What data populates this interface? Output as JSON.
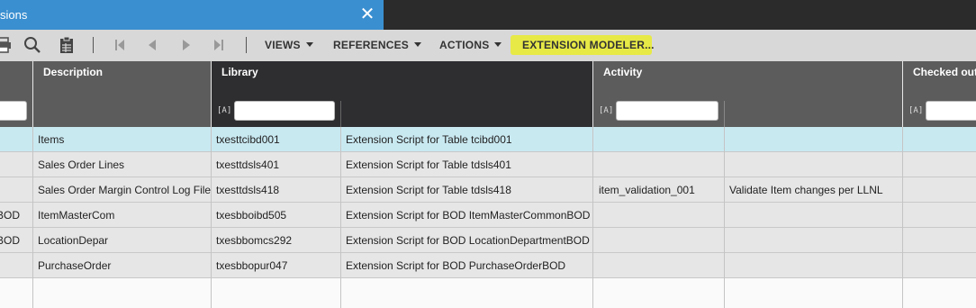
{
  "window": {
    "tab_title": "sions",
    "close_glyph": "✕"
  },
  "toolbar": {
    "icons": [
      "print-icon",
      "search-icon",
      "table-icon",
      "first-record-icon",
      "previous-record-icon",
      "next-record-icon",
      "last-record-icon"
    ],
    "menus": {
      "views": "VIEWS",
      "references": "REFERENCES",
      "actions": "ACTIONS",
      "extension_modeler": "EXTENSION MODELER..."
    },
    "highlight_color": "#e8ea3a"
  },
  "columns": {
    "description": "Description",
    "library": "Library",
    "activity": "Activity",
    "checked_out": "Checked out",
    "filter_tag": "[A]"
  },
  "rows": [
    {
      "c0": "",
      "description": "Items",
      "library": "txesttcibd001",
      "lib_desc": "Extension Script for Table tcibd001",
      "activity": "",
      "activity_desc": ""
    },
    {
      "c0": "",
      "description": "Sales Order Lines",
      "library": "txesttdsls401",
      "lib_desc": "Extension Script for Table tdsls401",
      "activity": "",
      "activity_desc": ""
    },
    {
      "c0": "",
      "description": "Sales Order Margin Control Log File",
      "library": "txesttdsls418",
      "lib_desc": "Extension Script for Table tdsls418",
      "activity": "item_validation_001",
      "activity_desc": "Validate Item changes per LLNL"
    },
    {
      "c0": "BOD",
      "description": "ItemMasterCom",
      "library": "txesbboibd505",
      "lib_desc": "Extension Script for BOD ItemMasterCommonBOD",
      "activity": "",
      "activity_desc": ""
    },
    {
      "c0": "BOD",
      "description": "LocationDepar",
      "library": "txesbbomcs292",
      "lib_desc": "Extension Script for BOD LocationDepartmentBOD",
      "activity": "",
      "activity_desc": ""
    },
    {
      "c0": "",
      "description": "PurchaseOrder",
      "library": "txesbbopur047",
      "lib_desc": "Extension Script for BOD PurchaseOrderBOD",
      "activity": "",
      "activity_desc": ""
    }
  ],
  "colors": {
    "selected_row": "#c9e9f1",
    "tab_blue": "#3a8fd0",
    "header_gray": "#5c5c5c",
    "header_dark": "#2e2e31"
  }
}
